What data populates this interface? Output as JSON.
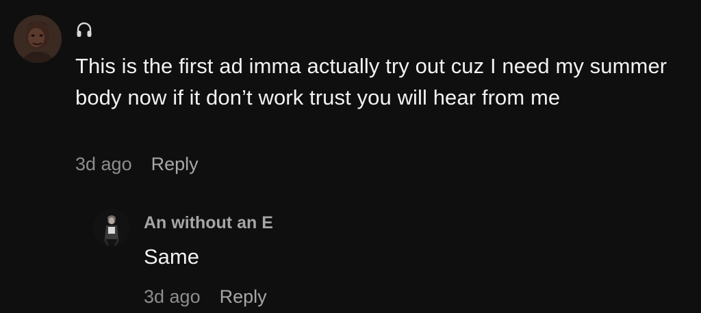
{
  "main_comment": {
    "avatar_icon": "user-photo-avatar",
    "badge_icon": "headphones-icon",
    "text": "This is the first ad imma actually try out cuz I need my summer body now if it don’t work trust you will hear from me",
    "timestamp": "3d ago",
    "reply_label": "Reply"
  },
  "reply_comment": {
    "avatar_icon": "user-photo-avatar",
    "username": "An without an E",
    "text": "Same",
    "timestamp": "3d ago",
    "reply_label": "Reply"
  },
  "colors": {
    "background": "#0f0f0f",
    "text_primary": "#f2f2f2",
    "text_secondary": "#8e8e8e",
    "username": "#a6a6a6"
  }
}
